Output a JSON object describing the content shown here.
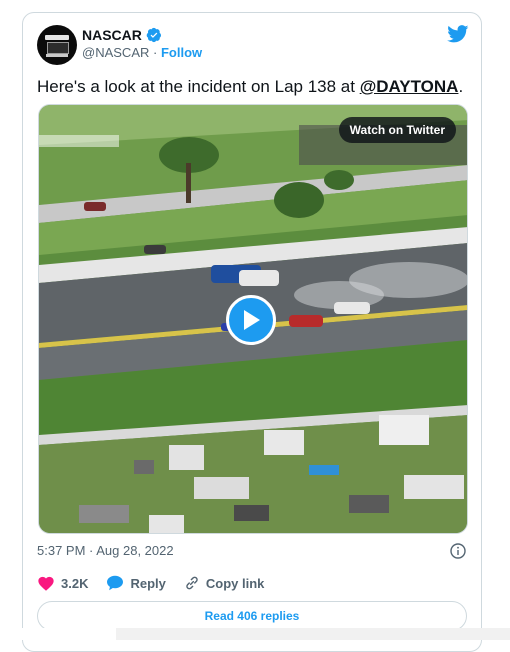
{
  "account": {
    "name": "NASCAR",
    "handle": "@NASCAR",
    "separator": "·",
    "follow_label": "Follow",
    "verified": true
  },
  "tweet": {
    "text_before": "Here's a look at the incident on Lap 138 at ",
    "mention": "@DAYTONA",
    "text_after": "."
  },
  "media": {
    "watch_label": "Watch on Twitter",
    "icon": "play-icon"
  },
  "meta": {
    "timestamp": "5:37 PM · Aug 28, 2022"
  },
  "actions": {
    "likes": "3.2K",
    "reply_label": "Reply",
    "copy_label": "Copy link"
  },
  "read_replies_label": "Read 406 replies",
  "colors": {
    "accent": "#1d9bf0",
    "like": "#f91880",
    "text": "#0f1419",
    "muted": "#536471"
  }
}
